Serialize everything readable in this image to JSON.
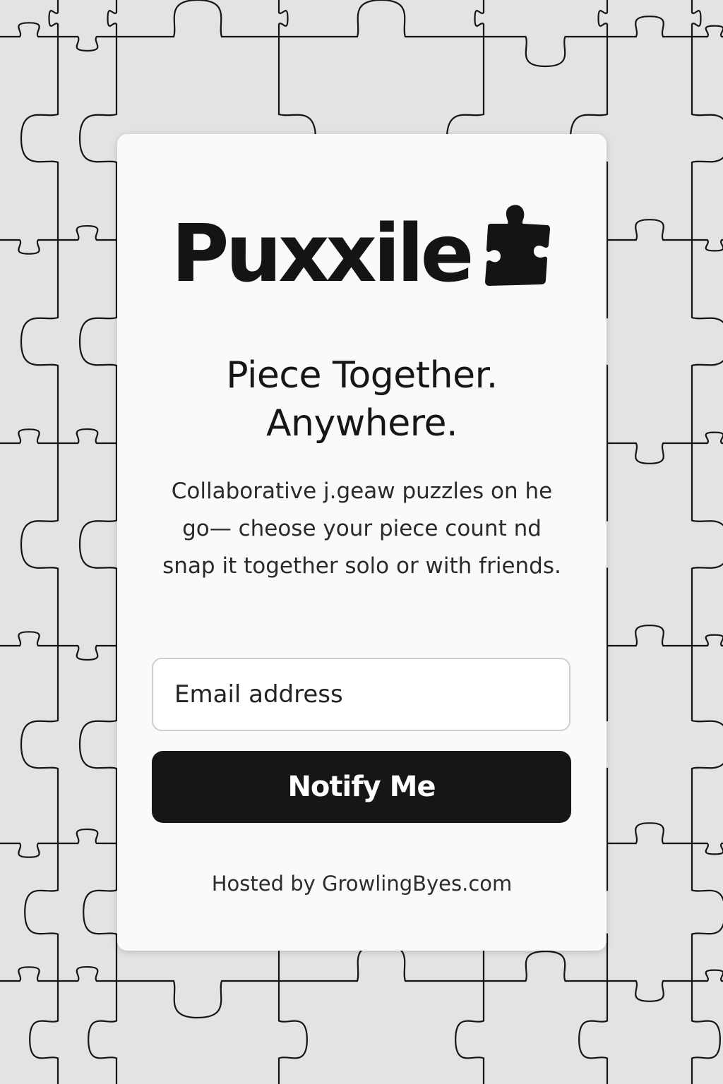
{
  "brand": {
    "name": "Puxxile",
    "icon": "puzzle-piece-icon"
  },
  "tagline": {
    "line1": "Piece Together.",
    "line2": "Anywhere."
  },
  "description": "Collaborative j.geaw puzzles on he go— cheose your piece count nd snap it together solo or with friends.",
  "form": {
    "email_placeholder": "Email address",
    "email_value": "",
    "submit_label": "Notify Me"
  },
  "footer": {
    "hosted_text": "Hosted by GrowlingByes.com"
  },
  "colors": {
    "background": "#e3e3e3",
    "card": "#fafafa",
    "button": "#161616",
    "text": "#141414"
  },
  "background_pattern": "jigsaw-puzzle-pattern"
}
